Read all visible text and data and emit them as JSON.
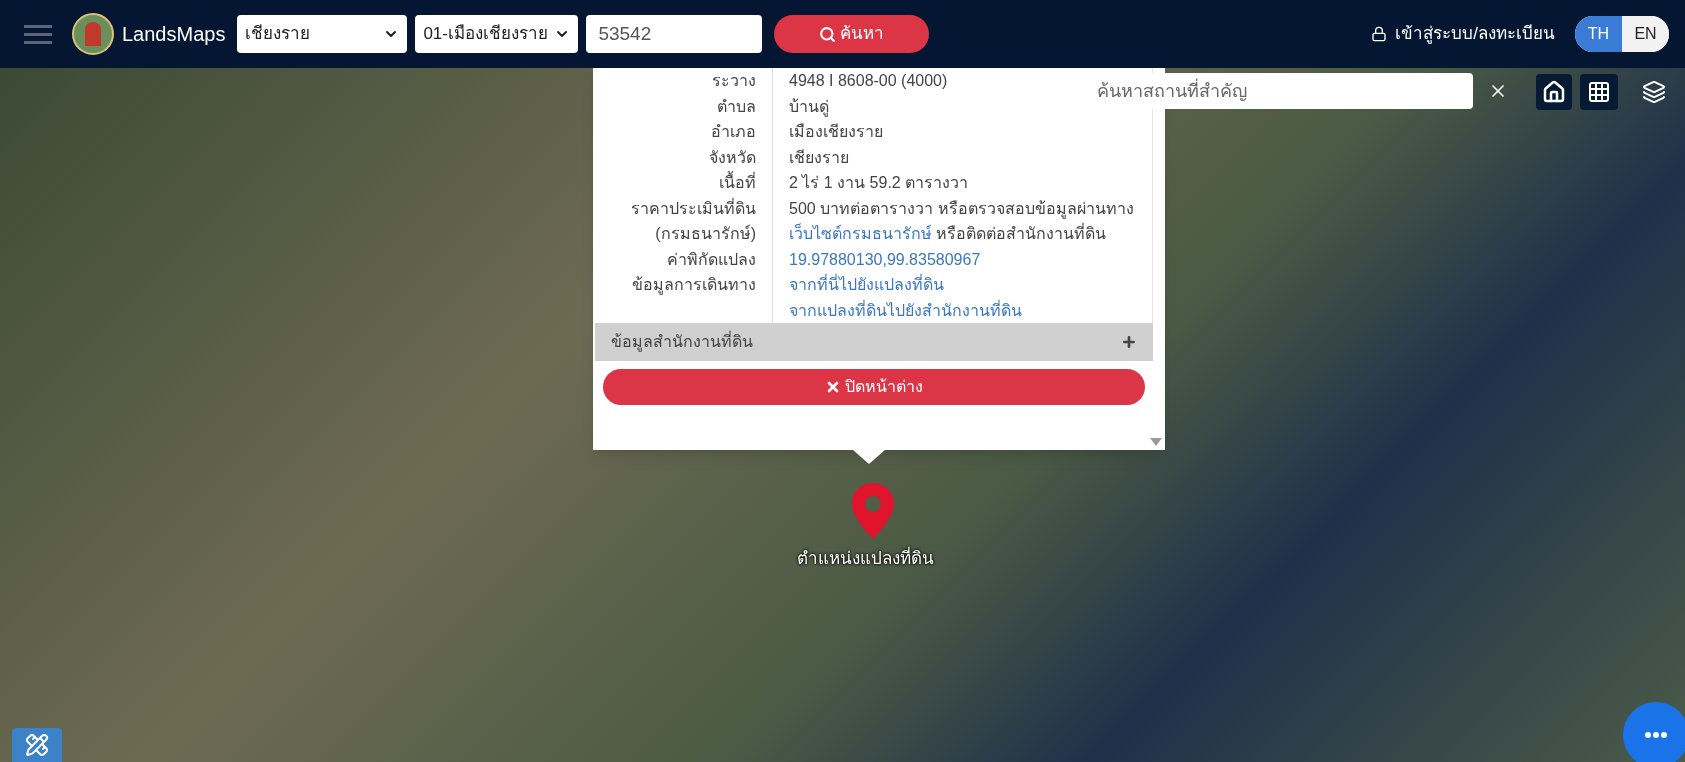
{
  "header": {
    "logo_text": "LandsMaps",
    "province": "เชียงราย",
    "district": "01-เมืองเชียงราย",
    "parcel_number": "53542",
    "search_button": "ค้นหา",
    "login": "เข้าสู่ระบบ/ลงทะเบียน",
    "languages": [
      {
        "label": "TH",
        "selected": true
      },
      {
        "label": "EN",
        "selected": false
      }
    ]
  },
  "popup": {
    "rows": [
      {
        "label": "ระวาง",
        "value": [
          {
            "text": "4948 I 8608-00 (4000)",
            "link": false
          }
        ]
      },
      {
        "label": "ตำบล",
        "value": [
          {
            "text": "บ้านดู่",
            "link": false
          }
        ]
      },
      {
        "label": "อำเภอ",
        "value": [
          {
            "text": "เมืองเชียงราย",
            "link": false
          }
        ]
      },
      {
        "label": "จังหวัด",
        "value": [
          {
            "text": "เชียงราย",
            "link": false
          }
        ]
      },
      {
        "label": "เนื้อที่",
        "value": [
          {
            "text": "2 ไร่ 1 งาน 59.2 ตารางวา",
            "link": false
          }
        ]
      },
      {
        "label": "ราคาประเมินที่ดิน",
        "value": [
          {
            "text": "500 บาทต่อตารางวา หรือตรวจสอบข้อมูลผ่านทาง",
            "link": false
          }
        ]
      },
      {
        "label": "(กรมธนารักษ์)",
        "value": [
          {
            "text": "เว็บไซต์กรมธนารักษ์",
            "link": true
          },
          {
            "text": "หรือติดต่อสำนักงานที่ดิน",
            "link": false
          }
        ]
      },
      {
        "label": "ค่าพิกัดแปลง",
        "value": [
          {
            "text": "19.97880130,99.83580967",
            "link": true
          }
        ]
      },
      {
        "label": "ข้อมูลการเดินทาง",
        "value": [
          {
            "text": "จากที่นี่ไปยังแปลงที่ดิน",
            "link": true
          }
        ]
      },
      {
        "label": "",
        "value": [
          {
            "text": "จากแปลงที่ดินไปยังสำนักงานที่ดิน",
            "link": true
          }
        ]
      }
    ],
    "section": {
      "title": "ข้อมูลสำนักงานที่ดิน",
      "expanded": false
    },
    "close_button": "ปิดหน้าต่าง"
  },
  "map": {
    "search": {
      "placeholder": "ค้นหาสถานที่สำคัญ"
    },
    "marker_label": "ตำแหน่งแปลงที่ดิน"
  }
}
